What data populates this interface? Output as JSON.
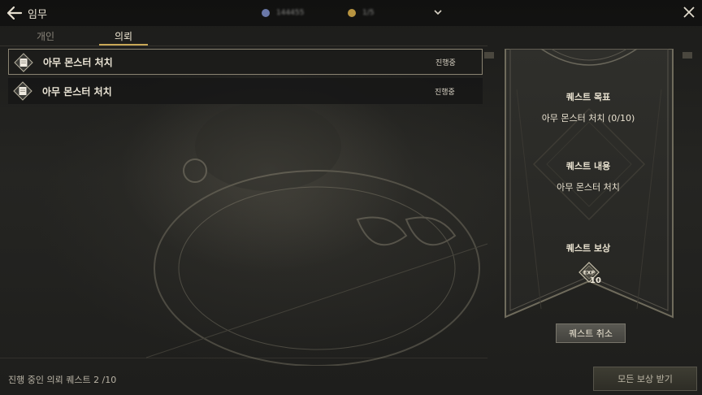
{
  "header": {
    "title": "임무",
    "currency_a": "144455",
    "currency_b": "1/5"
  },
  "tabs": [
    {
      "label": "개인",
      "active": false
    },
    {
      "label": "의뢰",
      "active": true
    }
  ],
  "quests": [
    {
      "name": "아무 몬스터 처치",
      "status": "진행중",
      "selected": true
    },
    {
      "name": "아무 몬스터 처치",
      "status": "진행중",
      "selected": false
    }
  ],
  "detail": {
    "goal_heading": "퀘스트 목표",
    "goal_value": "아무 몬스터 처치 (0/10)",
    "content_heading": "퀘스트 내용",
    "content_value": "아무 몬스터 처치",
    "reward_heading": "퀘스트 보상",
    "reward_icon": "exp-icon",
    "reward_count": "10",
    "cancel_label": "퀘스트 취소"
  },
  "footer": {
    "progress_text": "진행 중인 의뢰 퀘스트 2 /10",
    "claim_all_label": "모든 보상 받기"
  },
  "colors": {
    "accent_gold": "#c9a857",
    "panel_frame": "#6f6b5c"
  }
}
